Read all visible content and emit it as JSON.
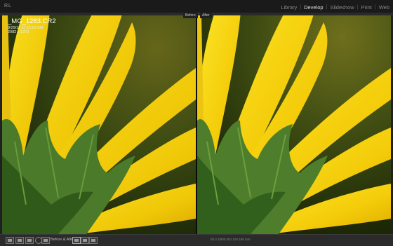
{
  "app": {
    "logo": "RL"
  },
  "modules": [
    {
      "label": "Library",
      "active": false
    },
    {
      "label": "Develop",
      "active": true
    },
    {
      "label": "Slideshow",
      "active": false
    },
    {
      "label": "Print",
      "active": false
    },
    {
      "label": "Web",
      "active": false
    }
  ],
  "photo": {
    "filename": "_MG_1283.CR2",
    "datetime": "8/29/16 11:16:03 AM",
    "dimensions": "2082 x 1373"
  },
  "compare": {
    "before": "Before",
    "after": "After"
  },
  "toolbar": {
    "view_mode_label": "Before & After",
    "readout": "f/6.3   1/800   ISO 100   180 mm"
  },
  "colors": {
    "petal": "#f2d20c",
    "sepal": "#4a7a2a",
    "background": "#3a4a10"
  }
}
